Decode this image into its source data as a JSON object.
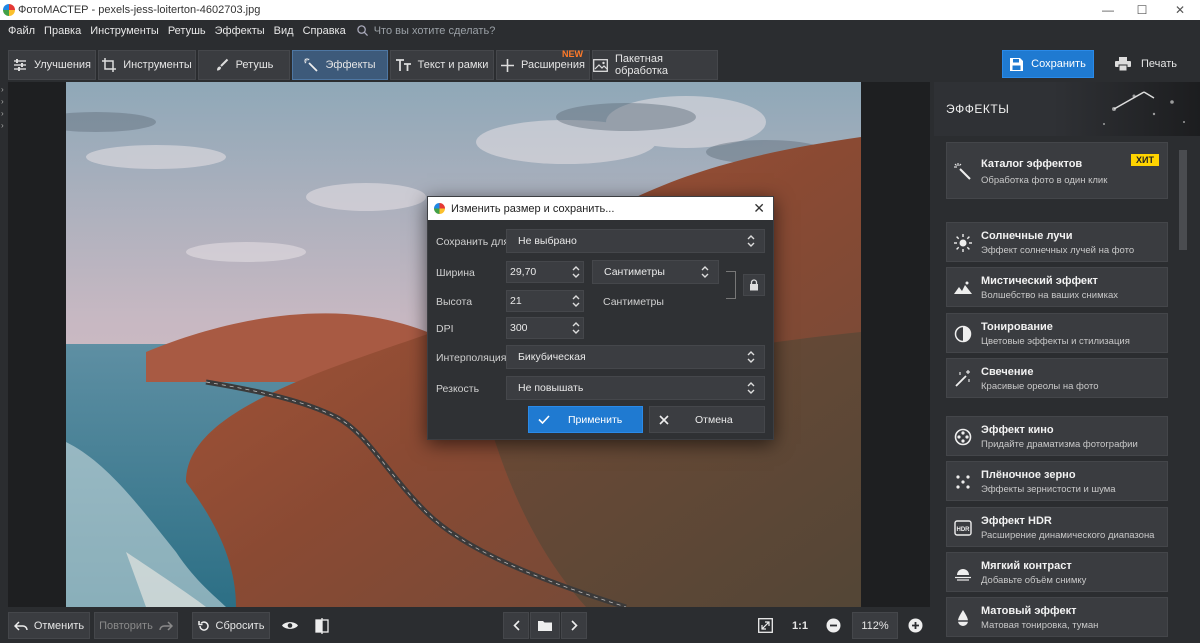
{
  "window": {
    "title": "ФотоМАСТЕР - pexels-jess-loiterton-4602703.jpg",
    "controls": [
      "—",
      "☐",
      "✕"
    ]
  },
  "menu": {
    "items": [
      "Файл",
      "Правка",
      "Инструменты",
      "Ретушь",
      "Эффекты",
      "Вид",
      "Справка"
    ],
    "search_placeholder": "Что вы хотите сделать?"
  },
  "toolbar": {
    "tabs": [
      {
        "label": "Улучшения",
        "icon": "sliders-icon"
      },
      {
        "label": "Инструменты",
        "icon": "crop-icon"
      },
      {
        "label": "Ретушь",
        "icon": "brush-icon"
      },
      {
        "label": "Эффекты",
        "icon": "magic-wand-icon",
        "active": true
      },
      {
        "label": "Текст и рамки",
        "icon": "text-icon"
      },
      {
        "label": "Расширения",
        "icon": "plus-icon",
        "badge": "NEW"
      },
      {
        "label": "Пакетная обработка",
        "icon": "images-icon"
      }
    ],
    "save_label": "Сохранить",
    "print_label": "Печать"
  },
  "panel": {
    "title": "ЭФФЕКТЫ",
    "catalog": {
      "title": "Каталог эффектов",
      "subtitle": "Обработка фото в один клик",
      "badge": "ХИТ"
    },
    "effects": [
      {
        "title": "Солнечные лучи",
        "subtitle": "Эффект солнечных лучей на фото",
        "icon": "sun-icon"
      },
      {
        "title": "Мистический эффект",
        "subtitle": "Волшебство на ваших снимках",
        "icon": "mountain-icon"
      },
      {
        "title": "Тонирование",
        "subtitle": "Цветовые эффекты и стилизация",
        "icon": "half-circle-icon"
      },
      {
        "title": "Свечение",
        "subtitle": "Красивые ореолы на фото",
        "icon": "sparkle-wand-icon"
      },
      {
        "title": "Эффект кино",
        "subtitle": "Придайте драматизма фотографии",
        "icon": "film-reel-icon"
      },
      {
        "title": "Плёночное зерно",
        "subtitle": "Эффекты зернистости и шума",
        "icon": "grain-icon"
      },
      {
        "title": "Эффект HDR",
        "subtitle": "Расширение динамического диапазона",
        "icon": "hdr-icon"
      },
      {
        "title": "Мягкий контраст",
        "subtitle": "Добавьте объём снимку",
        "icon": "soft-contrast-icon"
      },
      {
        "title": "Матовый эффект",
        "subtitle": "Матовая тонировка, туман",
        "icon": "matte-icon"
      }
    ]
  },
  "bottom": {
    "undo_label": "Отменить",
    "redo_label": "Повторить",
    "reset_label": "Сбросить",
    "ratio_label": "1:1",
    "zoom_value": "112%"
  },
  "dialog": {
    "title": "Изменить размер и сохранить...",
    "save_for_label": "Сохранить для",
    "save_for_value": "Не выбрано",
    "width_label": "Ширина",
    "width_value": "29,70",
    "unit_value": "Сантиметры",
    "height_label": "Высота",
    "height_value": "21",
    "height_unit": "Сантиметры",
    "dpi_label": "DPI",
    "dpi_value": "300",
    "interp_label": "Интерполяция",
    "interp_value": "Бикубическая",
    "sharp_label": "Резкость",
    "sharp_value": "Не повышать",
    "apply_label": "Применить",
    "cancel_label": "Отмена"
  }
}
